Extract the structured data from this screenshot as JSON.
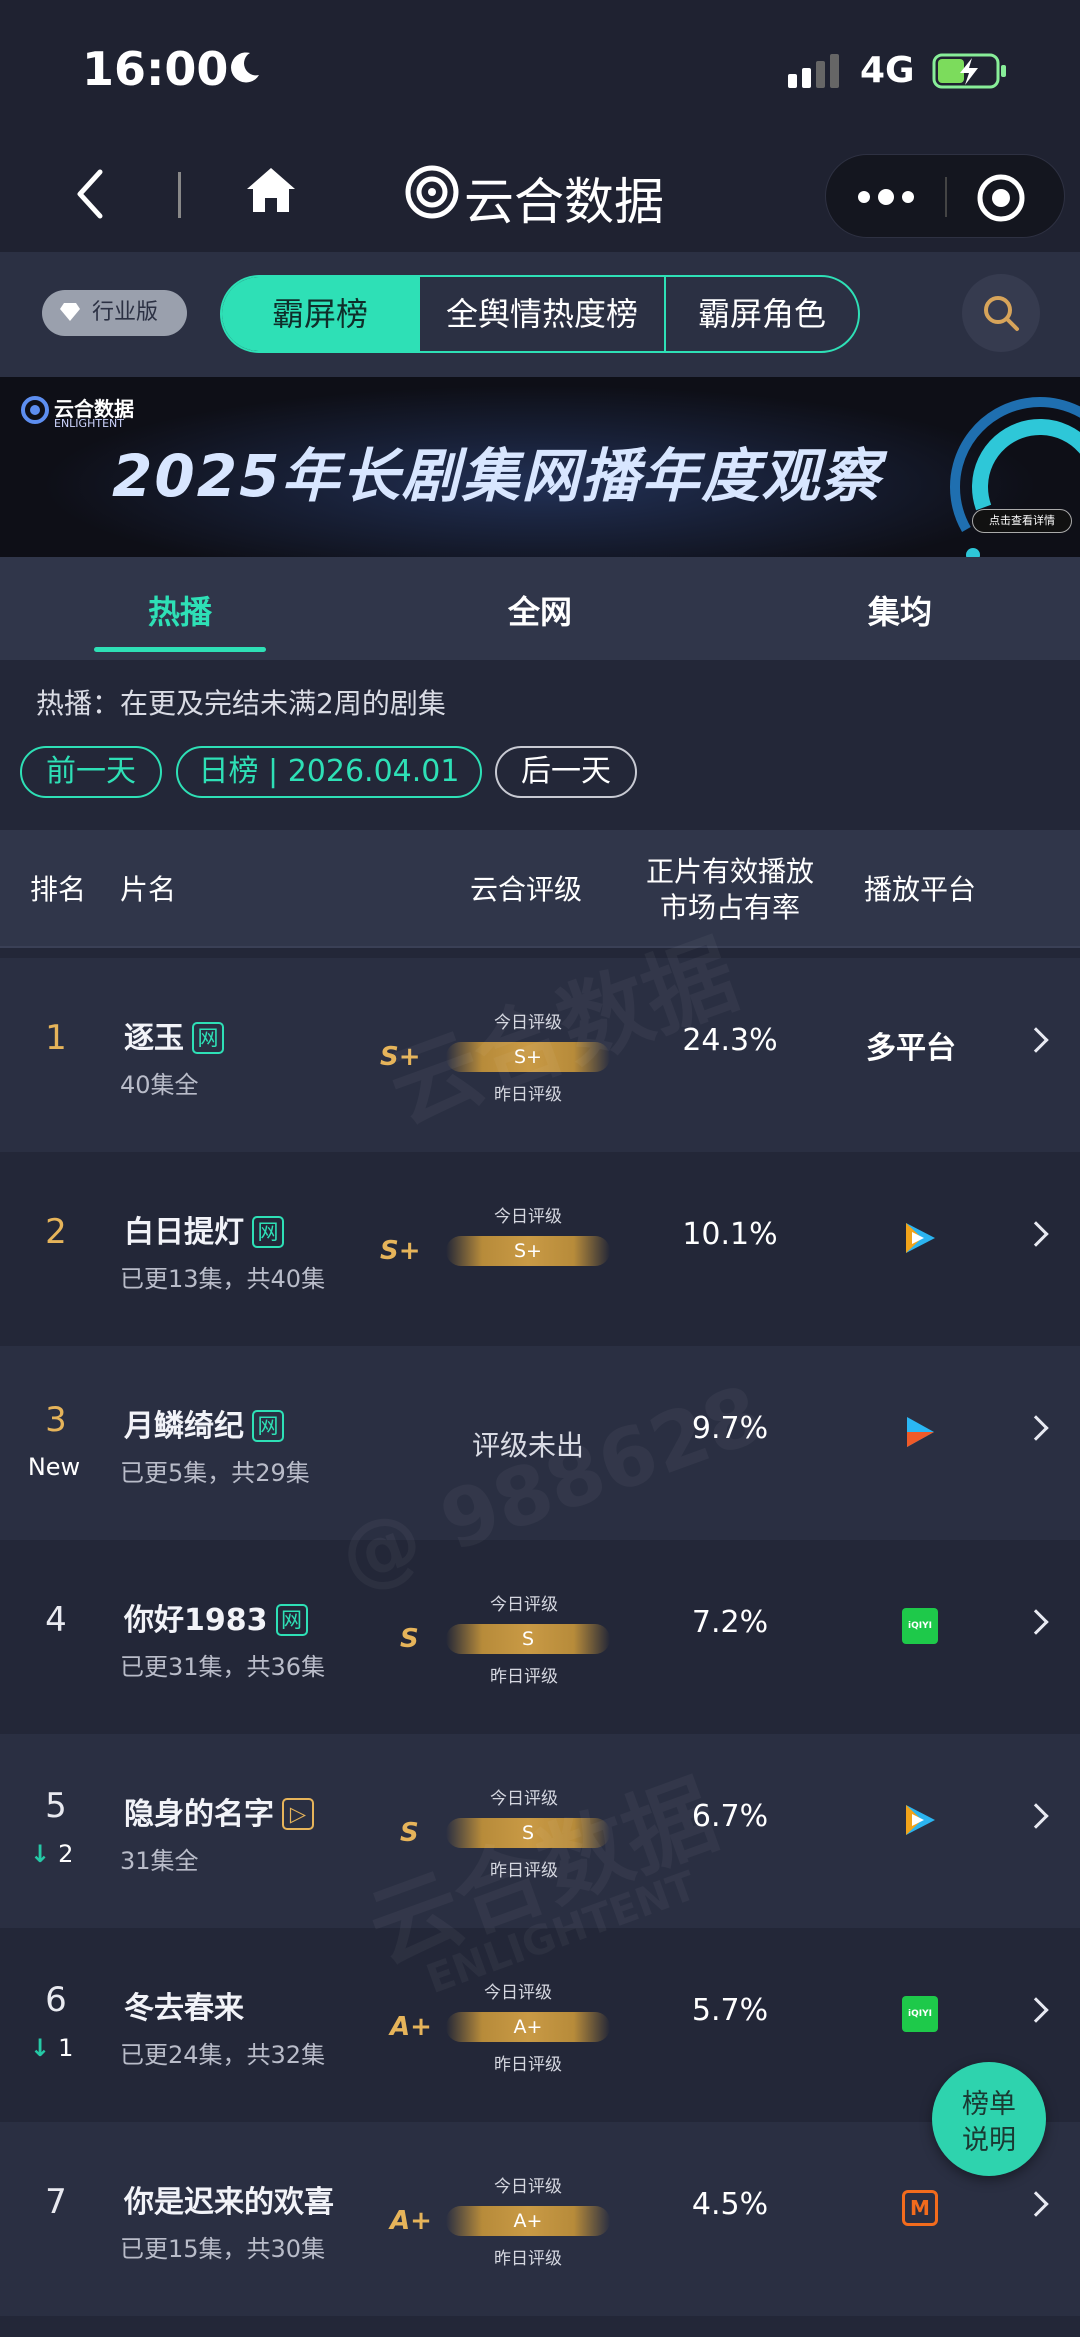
{
  "status_bar": {
    "time": "16:00",
    "network": "4G"
  },
  "nav": {
    "app_title": "云合数据"
  },
  "filter": {
    "edition_label": "行业版",
    "segments": [
      "霸屏榜",
      "全舆情热度榜",
      "霸屏角色"
    ]
  },
  "banner": {
    "brand": "云合数据",
    "brand_en": "ENLIGHTENT",
    "title": "2025年长剧集网播年度观察",
    "cta": "点击查看详情"
  },
  "tabs": [
    "热播",
    "全网",
    "集均"
  ],
  "info": {
    "note": "热播：在更及完结未满2周的剧集",
    "prev_day": "前一天",
    "date_label": "日榜 | 2026.04.01",
    "next_day": "后一天"
  },
  "table_header": {
    "rank": "排名",
    "name": "片名",
    "rating": "云合评级",
    "share_line1": "正片有效播放",
    "share_line2": "市场占有率",
    "platform": "播放平台"
  },
  "grade_labels": {
    "today": "今日评级",
    "yesterday": "昨日评级",
    "pending": "评级未出"
  },
  "rows": [
    {
      "rank": "1",
      "title": "逐玉",
      "tag": "网",
      "sub": "40集全",
      "grade": "S+",
      "share": "24.3%",
      "platform": "多平台"
    },
    {
      "rank": "2",
      "title": "白日提灯",
      "tag": "网",
      "sub": "已更13集，共40集",
      "grade": "S+",
      "share": "10.1%",
      "platform": "tencent-video-icon"
    },
    {
      "rank": "3",
      "badge": "New",
      "title": "月鳞绮纪",
      "tag": "网",
      "sub": "已更5集，共29集",
      "grade": "",
      "share": "9.7%",
      "platform": "youku-icon"
    },
    {
      "rank": "4",
      "title": "你好1983",
      "tag": "网",
      "sub": "已更31集，共36集",
      "grade": "S",
      "share": "7.2%",
      "platform": "iqiyi-icon"
    },
    {
      "rank": "5",
      "change": "2",
      "title": "隐身的名字",
      "tag": "▷",
      "sub": "31集全",
      "grade": "S",
      "share": "6.7%",
      "platform": "tencent-video-icon"
    },
    {
      "rank": "6",
      "change": "1",
      "title": "冬去春来",
      "sub": "已更24集，共32集",
      "grade": "A+",
      "share": "5.7%",
      "platform": "iqiyi-icon"
    },
    {
      "rank": "7",
      "title": "你是迟来的欢喜",
      "sub": "已更15集，共30集",
      "grade": "A+",
      "share": "4.5%",
      "platform": "mgtv-icon"
    }
  ],
  "fab": {
    "line1": "榜单",
    "line2": "说明"
  },
  "watermark": {
    "brand": "云合数据",
    "brand_en": "ENLIGHTENT",
    "id": "@ 988628"
  },
  "colors": {
    "accent": "#2ee0b6",
    "gold": "#e6b45a",
    "bg": "#232738"
  }
}
